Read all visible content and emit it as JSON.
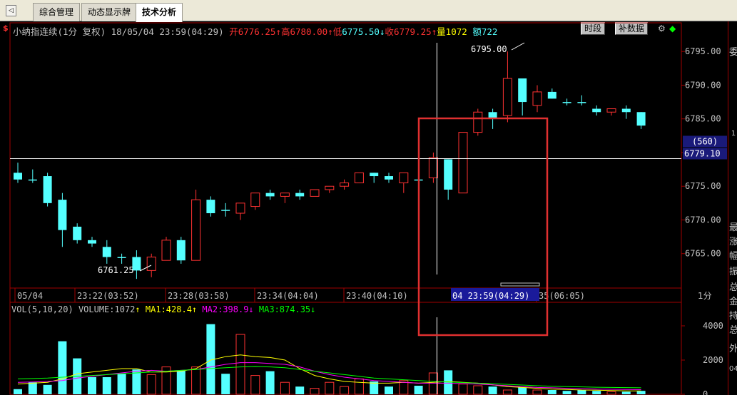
{
  "tabs": {
    "nav": "◁",
    "items": [
      {
        "label": "综合管理",
        "active": false
      },
      {
        "label": "动态显示牌",
        "active": false
      },
      {
        "label": "技术分析",
        "active": true
      }
    ]
  },
  "header": {
    "symbol": "小纳指连续(1分 复权)",
    "datetime": "18/05/04 23:59(04:29)",
    "open_label": "开",
    "open": "6776.25",
    "high_label": "高",
    "high": "6780.00",
    "low_label": "低",
    "low": "6775.50",
    "close_label": "收",
    "close": "6779.25",
    "volume_label": "量",
    "volume": "1072",
    "amount_label": "额",
    "amount": "722",
    "btn_period": "时段",
    "btn_fill": "补数据"
  },
  "price_axis": {
    "ticks": [
      "6795.00",
      "6790.00",
      "6785.00",
      "6780.00",
      "6775.00",
      "6770.00",
      "6765.00"
    ],
    "current_badge": "(560)",
    "current_price": "6779.10"
  },
  "annotations": {
    "high_label": "6795.00",
    "low_label": "6761.25"
  },
  "time_axis": {
    "labels": [
      "05/04",
      "23:22(03:52)",
      "23:28(03:58)",
      "23:34(04:04)",
      "23:40(04:10)",
      "35(06:05)"
    ],
    "cursor_label": "04 23:59(04:29)",
    "period": "1分"
  },
  "volume_panel": {
    "legend_name": "VOL(5,10,20)",
    "legend_volume": "VOLUME:1072",
    "ma1": "MA1:428.4",
    "ma2": "MA2:398.9",
    "ma3": "MA3:874.35",
    "ma1_arrow": "↑",
    "ma2_arrow": "↑",
    "ma3_arrow": "↓",
    "ticks": [
      "4000",
      "2000",
      "0"
    ]
  },
  "side_panel": {
    "chars": [
      "委",
      "最",
      "涨",
      "幅",
      "振",
      "总",
      "金",
      "持",
      "总",
      "外"
    ],
    "small": [
      "1",
      "04"
    ]
  },
  "colors": {
    "up": "#ff3232",
    "down": "#54ffff",
    "axis": "#a00000",
    "grid": "#a00000",
    "ma1": "#ffff00",
    "ma2": "#ff00ff",
    "ma3": "#00ff00",
    "highlight_box": "#e03030"
  },
  "chart_data": {
    "type": "candlestick",
    "price_range": [
      6760.0,
      6796.5
    ],
    "ylim_volume": [
      0,
      4500
    ],
    "candles": [
      {
        "o": 6777.0,
        "h": 6778.5,
        "l": 6775.5,
        "c": 6776.0
      },
      {
        "o": 6776.0,
        "h": 6777.5,
        "l": 6775.5,
        "c": 6776.0
      },
      {
        "o": 6776.5,
        "h": 6777.0,
        "l": 6772.0,
        "c": 6772.5
      },
      {
        "o": 6773.0,
        "h": 6774.0,
        "l": 6766.0,
        "c": 6768.5
      },
      {
        "o": 6769.0,
        "h": 6769.5,
        "l": 6766.5,
        "c": 6767.0
      },
      {
        "o": 6767.0,
        "h": 6767.5,
        "l": 6766.0,
        "c": 6766.5
      },
      {
        "o": 6766.0,
        "h": 6767.0,
        "l": 6763.5,
        "c": 6764.5
      },
      {
        "o": 6764.5,
        "h": 6765.0,
        "l": 6763.5,
        "c": 6764.5
      },
      {
        "o": 6764.5,
        "h": 6765.5,
        "l": 6761.25,
        "c": 6762.5
      },
      {
        "o": 6762.5,
        "h": 6765.0,
        "l": 6761.5,
        "c": 6764.5
      },
      {
        "o": 6764.0,
        "h": 6767.5,
        "l": 6764.0,
        "c": 6767.0
      },
      {
        "o": 6767.0,
        "h": 6767.5,
        "l": 6763.5,
        "c": 6764.0
      },
      {
        "o": 6764.0,
        "h": 6774.5,
        "l": 6764.0,
        "c": 6773.0
      },
      {
        "o": 6773.0,
        "h": 6773.5,
        "l": 6770.5,
        "c": 6771.0
      },
      {
        "o": 6771.5,
        "h": 6772.5,
        "l": 6770.5,
        "c": 6771.5
      },
      {
        "o": 6771.0,
        "h": 6772.5,
        "l": 6770.0,
        "c": 6772.5
      },
      {
        "o": 6772.0,
        "h": 6774.0,
        "l": 6771.5,
        "c": 6774.0
      },
      {
        "o": 6774.0,
        "h": 6774.5,
        "l": 6773.0,
        "c": 6773.5
      },
      {
        "o": 6773.5,
        "h": 6774.0,
        "l": 6772.5,
        "c": 6774.0
      },
      {
        "o": 6774.0,
        "h": 6774.5,
        "l": 6773.0,
        "c": 6773.5
      },
      {
        "o": 6773.5,
        "h": 6774.5,
        "l": 6773.5,
        "c": 6774.5
      },
      {
        "o": 6774.5,
        "h": 6775.0,
        "l": 6774.0,
        "c": 6775.0
      },
      {
        "o": 6775.0,
        "h": 6776.0,
        "l": 6774.5,
        "c": 6775.5
      },
      {
        "o": 6775.5,
        "h": 6777.0,
        "l": 6775.5,
        "c": 6777.0
      },
      {
        "o": 6777.0,
        "h": 6777.0,
        "l": 6775.5,
        "c": 6776.5
      },
      {
        "o": 6776.5,
        "h": 6777.0,
        "l": 6775.5,
        "c": 6776.0
      },
      {
        "o": 6775.5,
        "h": 6777.0,
        "l": 6774.0,
        "c": 6777.0
      },
      {
        "o": 6776.0,
        "h": 6776.5,
        "l": 6775.5,
        "c": 6776.0
      },
      {
        "o": 6776.25,
        "h": 6780.0,
        "l": 6775.5,
        "c": 6779.25
      },
      {
        "o": 6779.0,
        "h": 6779.0,
        "l": 6773.0,
        "c": 6774.5
      },
      {
        "o": 6774.0,
        "h": 6783.0,
        "l": 6774.0,
        "c": 6783.0
      },
      {
        "o": 6783.0,
        "h": 6786.5,
        "l": 6782.5,
        "c": 6786.0
      },
      {
        "o": 6786.0,
        "h": 6786.5,
        "l": 6783.5,
        "c": 6785.0
      },
      {
        "o": 6785.5,
        "h": 6795.0,
        "l": 6784.5,
        "c": 6791.0
      },
      {
        "o": 6791.0,
        "h": 6791.0,
        "l": 6785.5,
        "c": 6787.5
      },
      {
        "o": 6787.0,
        "h": 6790.0,
        "l": 6786.0,
        "c": 6789.0
      },
      {
        "o": 6789.0,
        "h": 6789.5,
        "l": 6788.0,
        "c": 6788.0
      },
      {
        "o": 6787.5,
        "h": 6788.0,
        "l": 6787.0,
        "c": 6787.5
      },
      {
        "o": 6787.5,
        "h": 6788.5,
        "l": 6787.0,
        "c": 6787.5
      },
      {
        "o": 6786.5,
        "h": 6787.0,
        "l": 6785.5,
        "c": 6786.0
      },
      {
        "o": 6786.0,
        "h": 6786.5,
        "l": 6785.5,
        "c": 6786.5
      },
      {
        "o": 6786.5,
        "h": 6787.0,
        "l": 6785.0,
        "c": 6786.0
      },
      {
        "o": 6786.0,
        "h": 6786.0,
        "l": 6783.5,
        "c": 6784.0
      }
    ],
    "volumes": [
      300,
      700,
      550,
      3100,
      2100,
      1000,
      1000,
      1200,
      1450,
      1150,
      1600,
      1400,
      1600,
      4100,
      1200,
      3500,
      1100,
      1350,
      700,
      450,
      350,
      700,
      450,
      900,
      750,
      450,
      800,
      500,
      1250,
      1400,
      600,
      500,
      450,
      250,
      400,
      250,
      250,
      200,
      250,
      200,
      150,
      150,
      200
    ],
    "ma1": [
      600,
      650,
      700,
      900,
      1200,
      1300,
      1400,
      1500,
      1500,
      1300,
      1300,
      1350,
      1500,
      2000,
      2200,
      2300,
      2200,
      2150,
      2000,
      1500,
      1100,
      900,
      750,
      700,
      650,
      650,
      700,
      650,
      700,
      750,
      700,
      650,
      550,
      450,
      400,
      350,
      300,
      280,
      250,
      240,
      220,
      200,
      200
    ],
    "ma2": [
      700,
      720,
      750,
      800,
      950,
      1050,
      1150,
      1250,
      1350,
      1400,
      1350,
      1400,
      1450,
      1600,
      1750,
      1850,
      1850,
      1800,
      1750,
      1600,
      1350,
      1150,
      1000,
      900,
      800,
      750,
      700,
      650,
      650,
      650,
      620,
      600,
      550,
      500,
      450,
      400,
      380,
      350,
      330,
      300,
      290,
      280,
      270
    ],
    "ma3": [
      900,
      920,
      950,
      1000,
      1050,
      1100,
      1150,
      1200,
      1250,
      1300,
      1350,
      1400,
      1450,
      1500,
      1550,
      1600,
      1620,
      1600,
      1550,
      1450,
      1350,
      1250,
      1150,
      1050,
      950,
      900,
      850,
      800,
      750,
      720,
      680,
      650,
      620,
      580,
      540,
      500,
      470,
      450,
      430,
      410,
      400,
      390,
      380
    ]
  }
}
